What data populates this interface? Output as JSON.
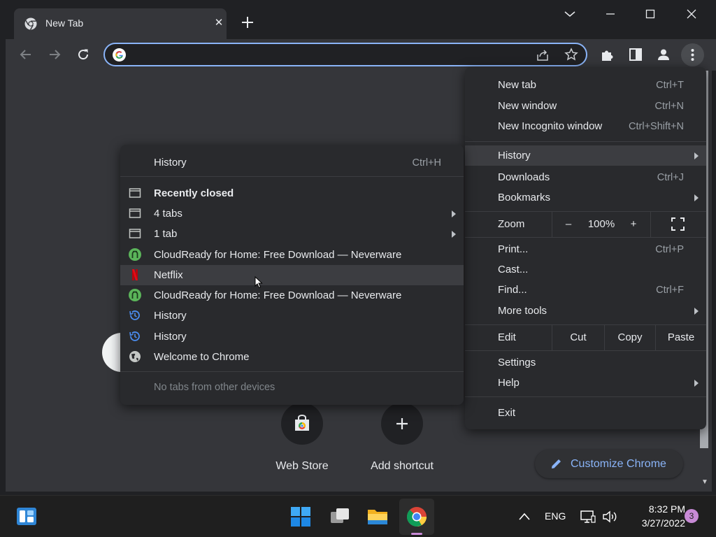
{
  "tab": {
    "title": "New Tab",
    "close_glyph": "✕"
  },
  "omnibox": {
    "value": "",
    "placeholder": ""
  },
  "page": {
    "shortcuts": [
      {
        "label": "Web Store"
      },
      {
        "label": "Add shortcut"
      }
    ],
    "customize_label": "Customize Chrome"
  },
  "main_menu": {
    "new_tab": {
      "label": "New tab",
      "shortcut": "Ctrl+T"
    },
    "new_window": {
      "label": "New window",
      "shortcut": "Ctrl+N"
    },
    "new_incognito": {
      "label": "New Incognito window",
      "shortcut": "Ctrl+Shift+N"
    },
    "history": {
      "label": "History"
    },
    "downloads": {
      "label": "Downloads",
      "shortcut": "Ctrl+J"
    },
    "bookmarks": {
      "label": "Bookmarks"
    },
    "zoom": {
      "label": "Zoom",
      "minus": "–",
      "level": "100%",
      "plus": "+"
    },
    "print": {
      "label": "Print...",
      "shortcut": "Ctrl+P"
    },
    "cast": {
      "label": "Cast..."
    },
    "find": {
      "label": "Find...",
      "shortcut": "Ctrl+F"
    },
    "more_tools": {
      "label": "More tools"
    },
    "edit": {
      "label": "Edit",
      "cut": "Cut",
      "copy": "Copy",
      "paste": "Paste"
    },
    "settings": {
      "label": "Settings"
    },
    "help": {
      "label": "Help"
    },
    "exit": {
      "label": "Exit"
    }
  },
  "history_menu": {
    "history": {
      "label": "History",
      "shortcut": "Ctrl+H"
    },
    "recently_closed": "Recently closed",
    "items": [
      {
        "label": "4 tabs",
        "icon": "window-icon"
      },
      {
        "label": "1 tab",
        "icon": "window-icon"
      },
      {
        "label": "CloudReady for Home: Free Download — Neverware",
        "icon": "neverware-icon"
      },
      {
        "label": "Netflix",
        "icon": "netflix-icon"
      },
      {
        "label": "CloudReady for Home: Free Download — Neverware",
        "icon": "neverware-icon"
      },
      {
        "label": "History",
        "icon": "history-icon"
      },
      {
        "label": "History",
        "icon": "history-icon"
      },
      {
        "label": "Welcome to Chrome",
        "icon": "globe-icon"
      }
    ],
    "footer": "No tabs from other devices"
  },
  "taskbar": {
    "language": "ENG",
    "time": "8:32 PM",
    "date": "3/27/2022",
    "notifications": "3"
  },
  "colors": {
    "accent": "#8ab4f8",
    "menu_bg": "#292a2d",
    "page_bg": "#35363a",
    "taskbar_indicator": "#c88ad6"
  }
}
